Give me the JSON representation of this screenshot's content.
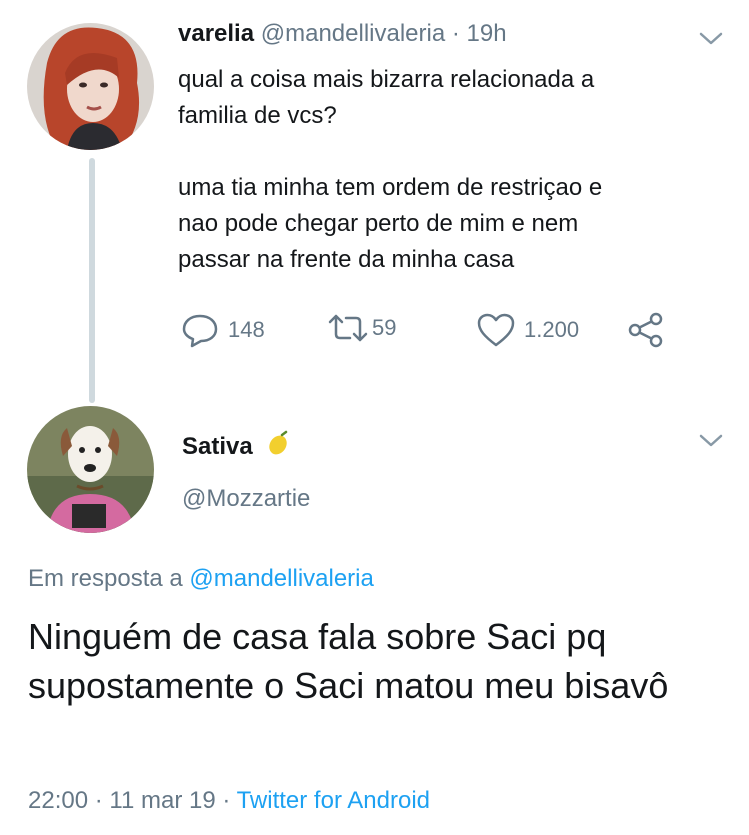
{
  "tweet1": {
    "display_name": "varelia",
    "handle": "@mandellivaleria",
    "separator": " · ",
    "time": "19h",
    "body": "qual a coisa mais bizarra relacionada a\nfamilia de vcs?\n\numa tia minha tem ordem de restriçao e\nnao pode chegar perto de mim e nem\npassar na frente da minha casa",
    "replies": "148",
    "retweets": "59",
    "likes": "1.200"
  },
  "tweet2": {
    "display_name": "Sativa",
    "emoji_icon": "lemon-icon",
    "handle": "@Mozzartie",
    "reply_prefix": "Em resposta a ",
    "reply_to": "@mandellivaleria",
    "body": "Ninguém de casa fala sobre Saci pq supostamente o Saci matou meu bisavô",
    "time": "22:00",
    "separator1": " · ",
    "date": "11 mar 19",
    "separator2": " · ",
    "client": "Twitter for Android"
  },
  "colors": {
    "text": "#14171a",
    "muted": "#657786",
    "link": "#1da1f2",
    "thread_line": "#cfd9de"
  }
}
